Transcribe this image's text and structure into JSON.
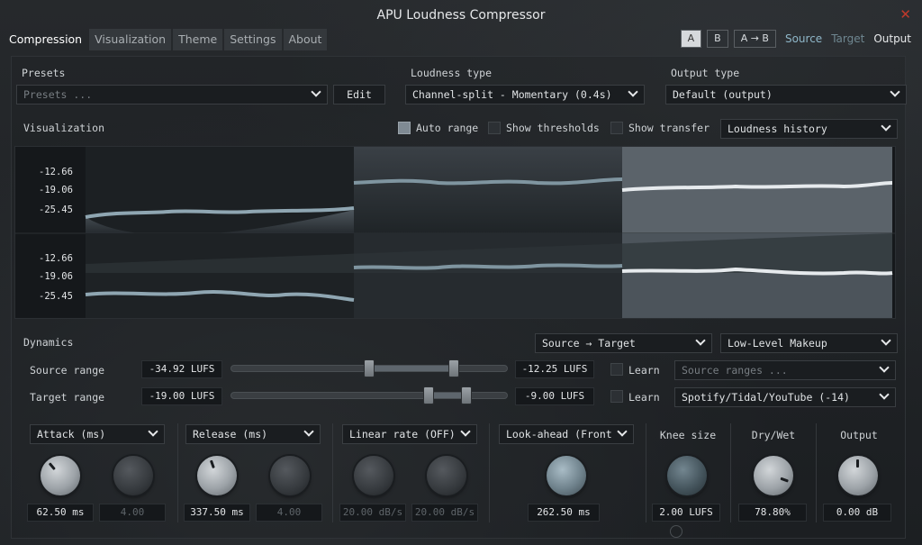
{
  "window": {
    "title": "APU Loudness Compressor",
    "close_glyph": "✕"
  },
  "tabs": [
    "Compression",
    "Visualization",
    "Theme",
    "Settings",
    "About"
  ],
  "ab": {
    "a": "A",
    "b": "B",
    "copy": "A → B",
    "source": "Source",
    "target": "Target",
    "output": "Output"
  },
  "presets": {
    "label": "Presets",
    "placeholder": "Presets ...",
    "edit": "Edit"
  },
  "loudness_type": {
    "label": "Loudness type",
    "value": "Channel-split - Momentary (0.4s)"
  },
  "output_type": {
    "label": "Output type",
    "value": "Default (output)"
  },
  "visualization": {
    "label": "Visualization",
    "auto_range": "Auto range",
    "show_thresholds": "Show thresholds",
    "show_transfer": "Show transfer",
    "mode": "Loudness history",
    "ticks_top": [
      "-12.66",
      "-19.06",
      "-25.45"
    ],
    "ticks_bottom": [
      "-12.66",
      "-19.06",
      "-25.45"
    ]
  },
  "dynamics": {
    "label": "Dynamics",
    "mode": "Source → Target",
    "makeup": "Low-Level Makeup",
    "source_range": {
      "label": "Source range",
      "low": "-34.92 LUFS",
      "high": "-12.25 LUFS",
      "learn": "Learn",
      "preset_placeholder": "Source ranges ..."
    },
    "target_range": {
      "label": "Target range",
      "low": "-19.00 LUFS",
      "high": "-9.00 LUFS",
      "learn": "Learn",
      "preset": "Spotify/Tidal/YouTube (-14)"
    }
  },
  "knobs": {
    "attack": {
      "label": "Attack (ms)",
      "value": "62.50 ms",
      "value2": "4.00"
    },
    "release": {
      "label": "Release (ms)",
      "value": "337.50 ms",
      "value2": "4.00"
    },
    "linear_rate": {
      "label": "Linear rate (OFF)",
      "value": "20.00 dB/s",
      "value2": "20.00 dB/s"
    },
    "lookahead": {
      "label": "Look-ahead (Front",
      "value": "262.50 ms"
    },
    "knee": {
      "label": "Knee size",
      "value": "2.00 LUFS"
    },
    "drywet": {
      "label": "Dry/Wet",
      "value": "78.80%"
    },
    "output": {
      "label": "Output",
      "value": "0.00 dB"
    }
  },
  "icons": {
    "chevron": "chevron-down-icon",
    "close": "close-icon"
  }
}
